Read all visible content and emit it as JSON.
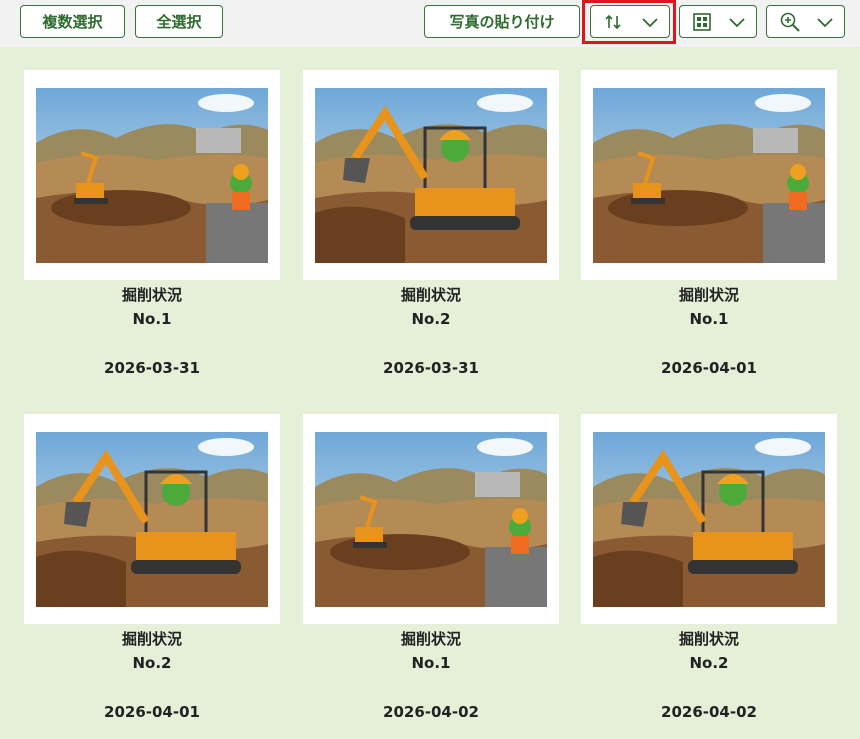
{
  "toolbar": {
    "multi_select_label": "複数選択",
    "select_all_label": "全選択",
    "paste_photo_label": "写真の貼り付け",
    "sort_icon": "sort-arrows-icon",
    "view_icon": "grid-view-icon",
    "zoom_icon": "zoom-in-icon",
    "accent_color": "#2f6b2f",
    "highlight_color": "#e0141c"
  },
  "photos": [
    {
      "title": "掘削状況",
      "number": "No.1",
      "date": "2026-03-31",
      "scene": "wide"
    },
    {
      "title": "掘削状況",
      "number": "No.2",
      "date": "2026-03-31",
      "scene": "close"
    },
    {
      "title": "掘削状況",
      "number": "No.1",
      "date": "2026-04-01",
      "scene": "wide"
    },
    {
      "title": "掘削状況",
      "number": "No.2",
      "date": "2026-04-01",
      "scene": "close"
    },
    {
      "title": "掘削状況",
      "number": "No.1",
      "date": "2026-04-02",
      "scene": "wide"
    },
    {
      "title": "掘削状況",
      "number": "No.2",
      "date": "2026-04-02",
      "scene": "close"
    }
  ]
}
